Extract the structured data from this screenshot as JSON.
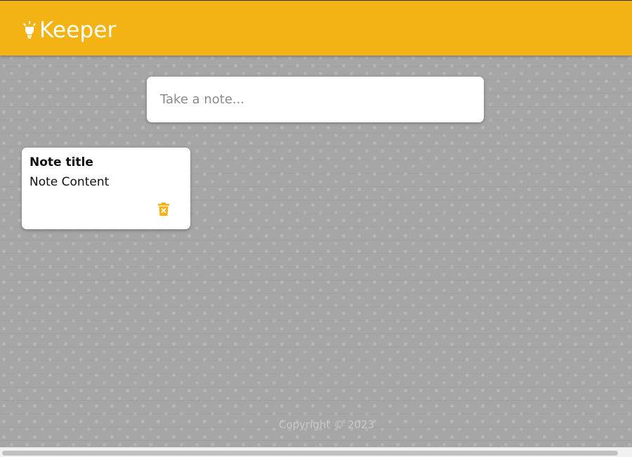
{
  "header": {
    "brand_name": "Keeper",
    "logo_icon": "lightbulb-icon",
    "color": "#f4b314"
  },
  "create_area": {
    "placeholder": "Take a note...",
    "value": ""
  },
  "notes": [
    {
      "title": "Note title",
      "content": "Note Content",
      "delete_icon": "delete-forever-icon",
      "icon_color": "#f4b314"
    }
  ],
  "footer": {
    "text": "Copyright © 2023"
  }
}
